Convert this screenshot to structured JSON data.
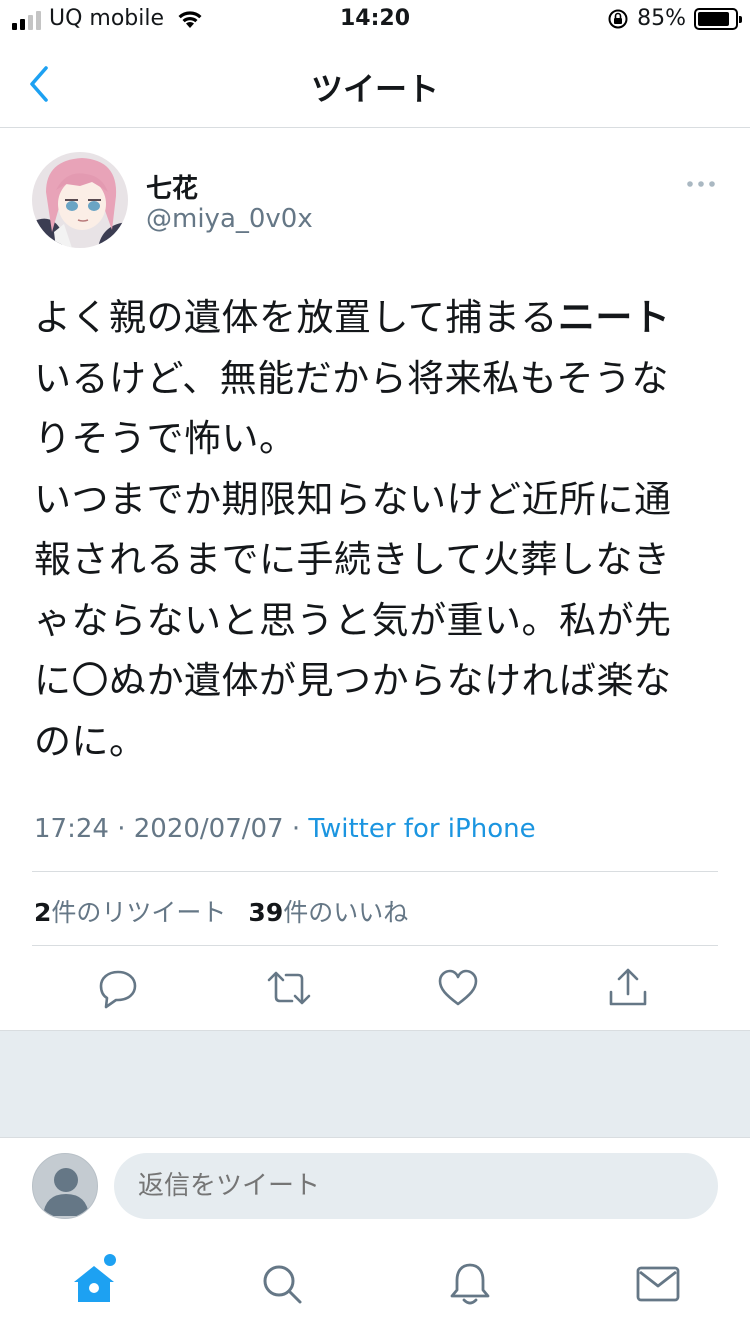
{
  "status_bar": {
    "carrier": "UQ mobile",
    "time": "14:20",
    "battery_percent": "85%",
    "battery_level": 0.85
  },
  "header": {
    "title": "ツイート"
  },
  "tweet": {
    "display_name": "七花",
    "handle": "@miya_0v0x",
    "text_segments": [
      {
        "text": "よく親の遺体を放置して捕まる",
        "bold": false
      },
      {
        "text": "ニート",
        "bold": true
      },
      {
        "text": "\nいるけど、無能だから将来私もそうな\nりそうで怖い。\nいつまでか期限知らないけど近所に通\n報されるまでに手続きして火葬しなき\nゃならないと思うと気が重い。私が先\nに〇ぬか遺体が見つからなければ楽な\nのに。",
        "bold": false
      }
    ],
    "time": "17:24",
    "date": "2020/07/07",
    "source": "Twitter for iPhone",
    "retweet_count": "2",
    "retweet_label": "件のリツイート",
    "like_count": "39",
    "like_label": "件のいいね"
  },
  "reply": {
    "placeholder": "返信をツイート"
  },
  "icons": {
    "back": "chevron-left-icon",
    "more": "more-horizontal-icon",
    "reply": "reply-icon",
    "retweet": "retweet-icon",
    "like": "heart-icon",
    "share": "share-icon",
    "home": "home-icon",
    "search": "search-icon",
    "notifications": "bell-icon",
    "messages": "mail-icon"
  },
  "colors": {
    "accent": "#1da1f2",
    "link": "#1b95e0",
    "secondary_text": "#657786",
    "icon_gray": "#657786"
  }
}
